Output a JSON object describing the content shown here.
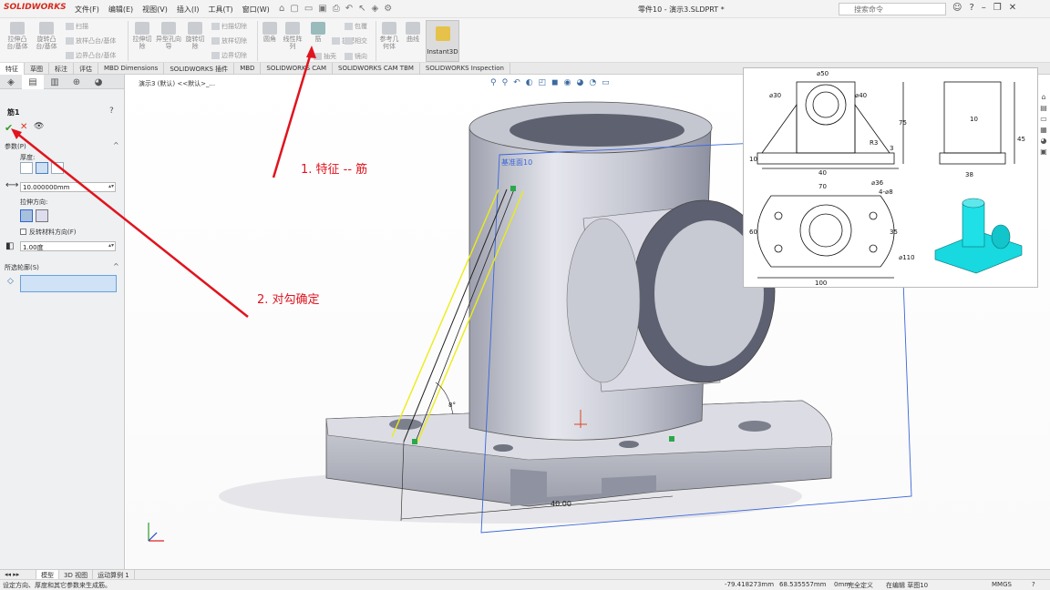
{
  "app": {
    "logo": "SOLIDWORKS",
    "title": "零件10 - 演示3.SLDPRT *"
  },
  "menu": [
    "文件(F)",
    "编辑(E)",
    "视图(V)",
    "插入(I)",
    "工具(T)",
    "窗口(W)"
  ],
  "search": {
    "placeholder": "搜索命令"
  },
  "ribbon": {
    "extrude_boss": "拉伸凸台/基体",
    "revolve_boss": "旋转凸台/基体",
    "sweep": "扫描",
    "loft_boss": "放样凸台/基体",
    "boundary_boss": "边界凸台/基体",
    "extrude_cut": "拉伸切除",
    "hole_wizard": "异型孔向导",
    "revolve_cut": "旋转切除",
    "sweep_cut": "扫描切除",
    "loft_cut": "放样切除",
    "boundary_cut": "边界切除",
    "fillet": "圆角",
    "linear_pattern": "线性阵列",
    "rib": "筋",
    "draft": "拔模",
    "shell": "抽壳",
    "wrap": "包覆",
    "intersect": "相交",
    "mirror": "镜向",
    "ref_geometry": "参考几何体",
    "curves": "曲线",
    "instant3d": "Instant3D"
  },
  "tabs": [
    "特征",
    "草图",
    "标注",
    "评估",
    "MBD Dimensions",
    "SOLIDWORKS 插件",
    "MBD",
    "SOLIDWORKS CAM",
    "SOLIDWORKS CAM TBM",
    "SOLIDWORKS Inspection"
  ],
  "property_manager": {
    "feature_title": "筋1",
    "params_group": "参数(P)",
    "thickness_label": "厚度:",
    "thickness_value": "10.000000mm",
    "direction_label": "拉伸方向:",
    "flip_label": "反转材料方向(F)",
    "draft_value": "1.00度",
    "contours_group": "所选轮廓(S)"
  },
  "viewport": {
    "breadcrumb": "演示3 (默认) <<默认>_...",
    "plane_label": "基准面10",
    "dim_value": "40.00",
    "angle_label": "8°"
  },
  "drawing": {
    "dims": [
      "⌀50",
      "⌀30",
      "⌀40",
      "75",
      "R3",
      "3",
      "10",
      "40",
      "10",
      "45",
      "38",
      "70",
      "⌀36",
      "4-⌀8",
      "60",
      "35",
      "⌀110",
      "100"
    ]
  },
  "annotations": {
    "step1": "1. 特征 -- 筋",
    "step2": "2. 对勾确定"
  },
  "bottom_tabs": [
    "模型",
    "3D 视图",
    "运动算例 1"
  ],
  "status": {
    "hint": "设定方向、厚度和其它参数来生成筋。",
    "x": "-79.418273mm",
    "y": "68.535557mm",
    "z": "0mm",
    "defined": "完全定义",
    "editing": "在编辑 草图10",
    "units": "MMGS"
  },
  "colors": {
    "annotation": "#e0141e",
    "part": "#c8cad3",
    "selection": "#cfe2f6",
    "plane": "#3a66d8",
    "iso_part": "#1ee0e6"
  }
}
